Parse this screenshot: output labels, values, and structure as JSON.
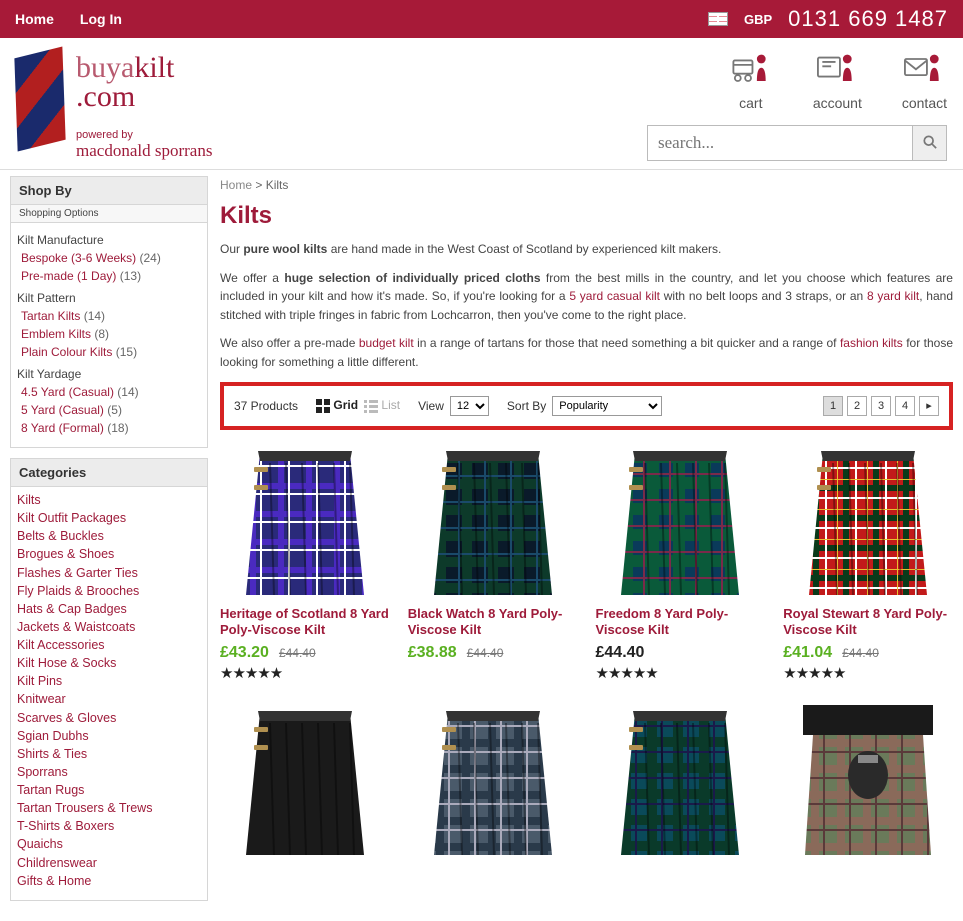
{
  "topbar": {
    "home": "Home",
    "login": "Log In",
    "currency": "GBP",
    "phone": "0131 669 1487"
  },
  "logo": {
    "line1a": "buya",
    "line1b": "kilt",
    "line2": ".com",
    "powered": "powered by",
    "sporrans": "macdonald sporrans"
  },
  "header_icons": {
    "cart": "cart",
    "account": "account",
    "contact": "contact"
  },
  "search": {
    "placeholder": "search..."
  },
  "sidebar": {
    "shopby_head": "Shop By",
    "shopby_sub": "Shopping Options",
    "filters": [
      {
        "label": "Kilt Manufacture",
        "items": [
          {
            "name": "Bespoke (3-6 Weeks)",
            "count": "(24)"
          },
          {
            "name": "Pre-made (1 Day)",
            "count": "(13)"
          }
        ]
      },
      {
        "label": "Kilt Pattern",
        "items": [
          {
            "name": "Tartan Kilts",
            "count": "(14)"
          },
          {
            "name": "Emblem Kilts",
            "count": "(8)"
          },
          {
            "name": "Plain Colour Kilts",
            "count": "(15)"
          }
        ]
      },
      {
        "label": "Kilt Yardage",
        "items": [
          {
            "name": "4.5 Yard (Casual)",
            "count": "(14)"
          },
          {
            "name": "5 Yard (Casual)",
            "count": "(5)"
          },
          {
            "name": "8 Yard (Formal)",
            "count": "(18)"
          }
        ]
      }
    ],
    "cat_head": "Categories",
    "categories": [
      "Kilts",
      "Kilt Outfit Packages",
      "Belts & Buckles",
      "Brogues & Shoes",
      "Flashes & Garter Ties",
      "Fly Plaids & Brooches",
      "Hats & Cap Badges",
      "Jackets & Waistcoats",
      "Kilt Accessories",
      "Kilt Hose & Socks",
      "Kilt Pins",
      "Knitwear",
      "Scarves & Gloves",
      "Sgian Dubhs",
      "Shirts & Ties",
      "Sporrans",
      "Tartan Rugs",
      "Tartan Trousers & Trews",
      "T-Shirts & Boxers",
      "Quaichs",
      "Childrenswear",
      "Gifts & Home"
    ]
  },
  "breadcrumb": {
    "home": "Home",
    "sep": " > ",
    "current": "Kilts"
  },
  "page_title": "Kilts",
  "desc": {
    "p1a": "Our ",
    "p1b": "pure wool kilts",
    "p1c": " are hand made in the West Coast of Scotland by experienced kilt makers.",
    "p2a": "We offer a ",
    "p2b": "huge selection of individually priced cloths",
    "p2c": " from the best mills in the country, and let you choose which features are included in your kilt and how it's made. So, if you're looking for a ",
    "p2d": "5 yard casual kilt",
    "p2e": " with no belt loops and 3 straps, or an ",
    "p2f": "8 yard kilt",
    "p2g": ", hand stitched with triple fringes in fabric from Lochcarron, then you've come to the right place.",
    "p3a": "We also offer a pre-made ",
    "p3b": "budget kilt",
    "p3c": " in a range of tartans for those that need something a bit quicker and a range of ",
    "p3d": "fashion kilts",
    "p3e": " for those looking for something a little different."
  },
  "toolbar": {
    "count": "37 Products",
    "grid": "Grid",
    "list": "List",
    "view": "View",
    "view_val": "12",
    "sort": "Sort By",
    "sort_val": "Popularity",
    "pages": [
      "1",
      "2",
      "3",
      "4",
      "▸"
    ],
    "current_page": 0
  },
  "products_row1": [
    {
      "name": "Heritage of Scotland 8 Yard Poly-Viscose Kilt",
      "sale": "£43.20",
      "old": "£44.40",
      "stars": 5,
      "tartan": "heritage"
    },
    {
      "name": "Black Watch 8 Yard Poly-Viscose Kilt",
      "sale": "£38.88",
      "old": "£44.40",
      "stars": 0,
      "tartan": "blackwatch"
    },
    {
      "name": "Freedom 8 Yard Poly-Viscose Kilt",
      "reg": "£44.40",
      "stars": 5,
      "tartan": "freedom"
    },
    {
      "name": "Royal Stewart 8 Yard Poly-Viscose Kilt",
      "sale": "£41.04",
      "old": "£44.40",
      "stars": 5,
      "tartan": "stewart"
    }
  ],
  "products_row2_tartans": [
    "black",
    "slate",
    "freedom2",
    "worn"
  ]
}
